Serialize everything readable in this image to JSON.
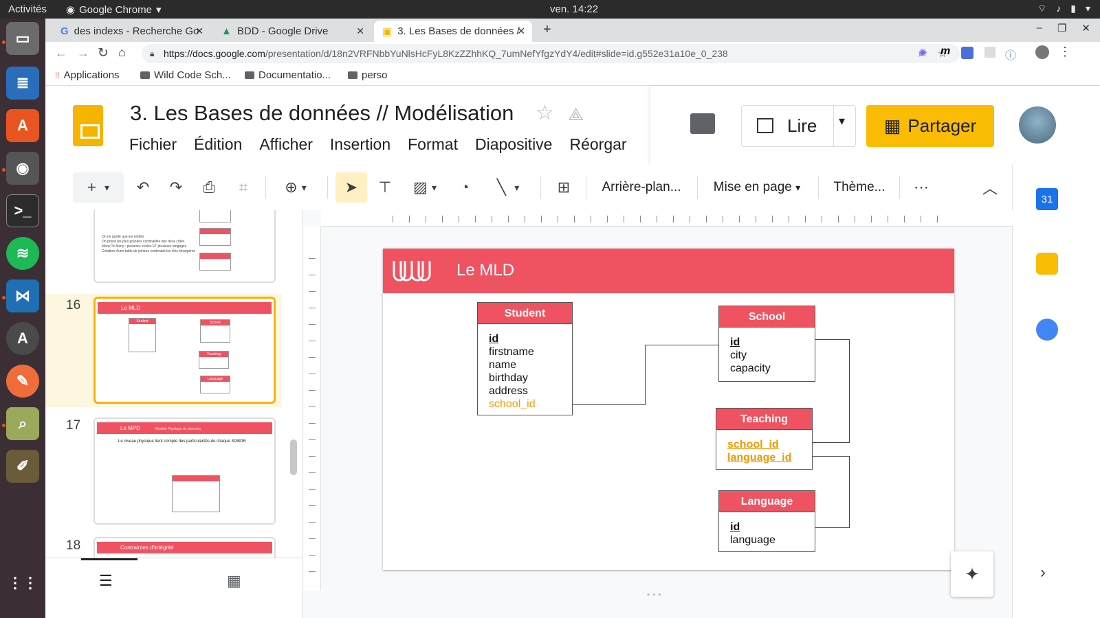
{
  "os": {
    "activities": "Activités",
    "app_name": "Google Chrome",
    "clock": "ven. 14:22"
  },
  "browser": {
    "tabs": [
      {
        "label": "des indexs - Recherche Go"
      },
      {
        "label": "BDD - Google Drive"
      },
      {
        "label": "3. Les Bases de données /"
      }
    ],
    "url_host": "https://docs.google.com",
    "url_path": "/presentation/d/18n2VRFNbbYuNlsHcFyL8KzZZhhKQ_7umNefYfgzYdY4/edit#slide=id.g552e31a10e_0_238",
    "bookmarks": [
      {
        "label": "Applications"
      },
      {
        "label": "Wild Code Sch..."
      },
      {
        "label": "Documentatio..."
      },
      {
        "label": "perso"
      }
    ]
  },
  "app": {
    "doc_title": "3. Les Bases de données // Modélisation",
    "menu": [
      "Fichier",
      "Édition",
      "Afficher",
      "Insertion",
      "Format",
      "Diapositive",
      "Réorgar"
    ],
    "present_label": "Lire",
    "share_label": "Partager",
    "toolbar_text": {
      "background": "Arrière-plan...",
      "layout": "Mise en page",
      "theme": "Thème..."
    }
  },
  "filmstrip": {
    "slides": [
      {
        "number": "16",
        "title": "Le MLD"
      },
      {
        "number": "17",
        "title": "Le MPD",
        "subtitle": "Modèle Physique de données",
        "text": "Le niveau physique tient compte des particularités de chaque SGBDR"
      },
      {
        "number": "18",
        "title": "Contraintes d'intégrité"
      }
    ],
    "prev_text": {
      "l1": "On ne garde que les entités",
      "l2": "On prend les plus grandes cardinalités des deux côtés",
      "l3": "Many To Many : plusieurs écoles ET plusieurs langages",
      "l4": "Création d'une table de jointure contenant les clés étrangères"
    }
  },
  "slide": {
    "title": "Le MLD",
    "entities": {
      "student": {
        "name": "Student",
        "fields": [
          "id",
          "firstname",
          "name",
          "birthday",
          "address",
          "school_id"
        ]
      },
      "school": {
        "name": "School",
        "fields": [
          "id",
          "city",
          "capacity"
        ]
      },
      "teaching": {
        "name": "Teaching",
        "fields": [
          "school_id",
          "language_id"
        ]
      },
      "language": {
        "name": "Language",
        "fields": [
          "id",
          "language"
        ]
      }
    }
  },
  "colors": {
    "accent_red": "#ef5361",
    "share_yellow": "#fbbc04",
    "foreign_key_orange": "#f29900"
  },
  "icons": {
    "calendar_day": "31"
  }
}
